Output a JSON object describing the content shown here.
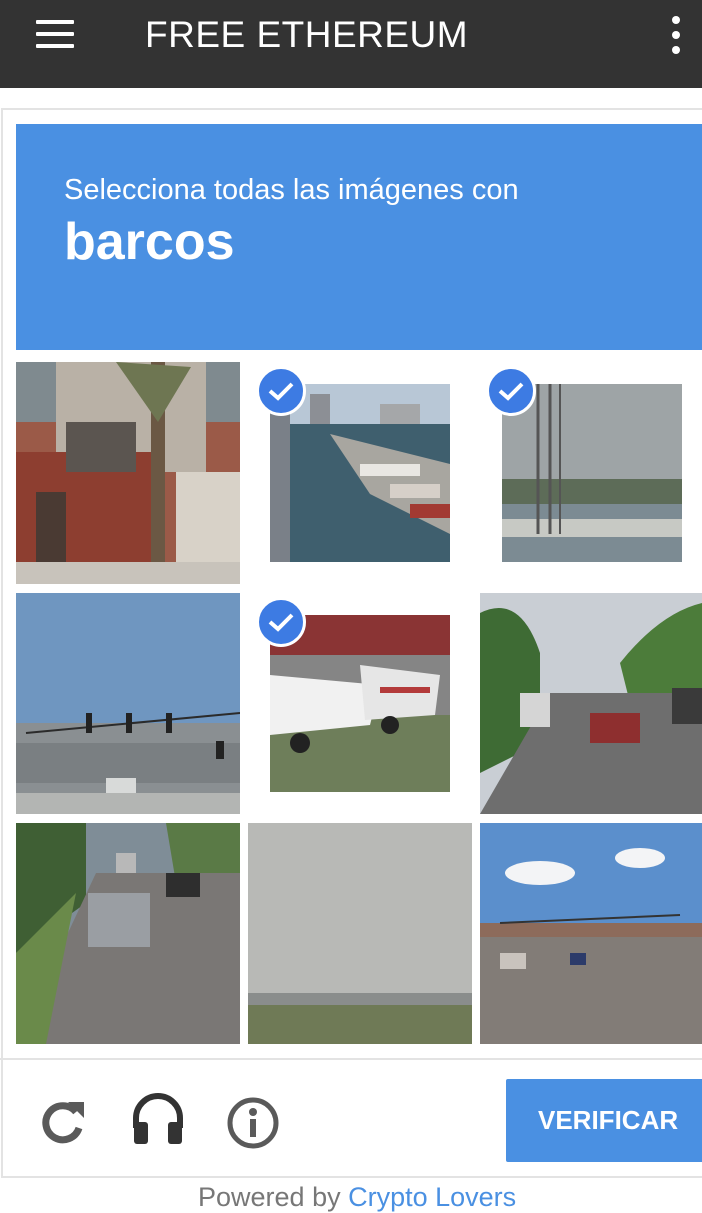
{
  "app_bar": {
    "title": "FREE ETHEREUM"
  },
  "captcha": {
    "instruction": "Selecciona todas las imágenes con",
    "target": "barcos",
    "tiles": [
      {
        "scene": "building-storefront",
        "selected": false
      },
      {
        "scene": "marina-boats",
        "selected": true
      },
      {
        "scene": "harbor-masts",
        "selected": true
      },
      {
        "scene": "intersection-traffic-lights",
        "selected": false
      },
      {
        "scene": "boats-on-trailers",
        "selected": true
      },
      {
        "scene": "highway-truck",
        "selected": false
      },
      {
        "scene": "road-cars",
        "selected": false
      },
      {
        "scene": "sky-horizon",
        "selected": false
      },
      {
        "scene": "street-intersection",
        "selected": false
      }
    ],
    "verify_label": "VERIFICAR",
    "icons": [
      "reload-icon",
      "headphones-icon",
      "info-icon"
    ]
  },
  "footer": {
    "powered_prefix": "Powered by",
    "powered_link": "Crypto Lovers"
  },
  "colors": {
    "accent": "#4a90e2",
    "check": "#3d7be3",
    "appbar": "#333333"
  }
}
